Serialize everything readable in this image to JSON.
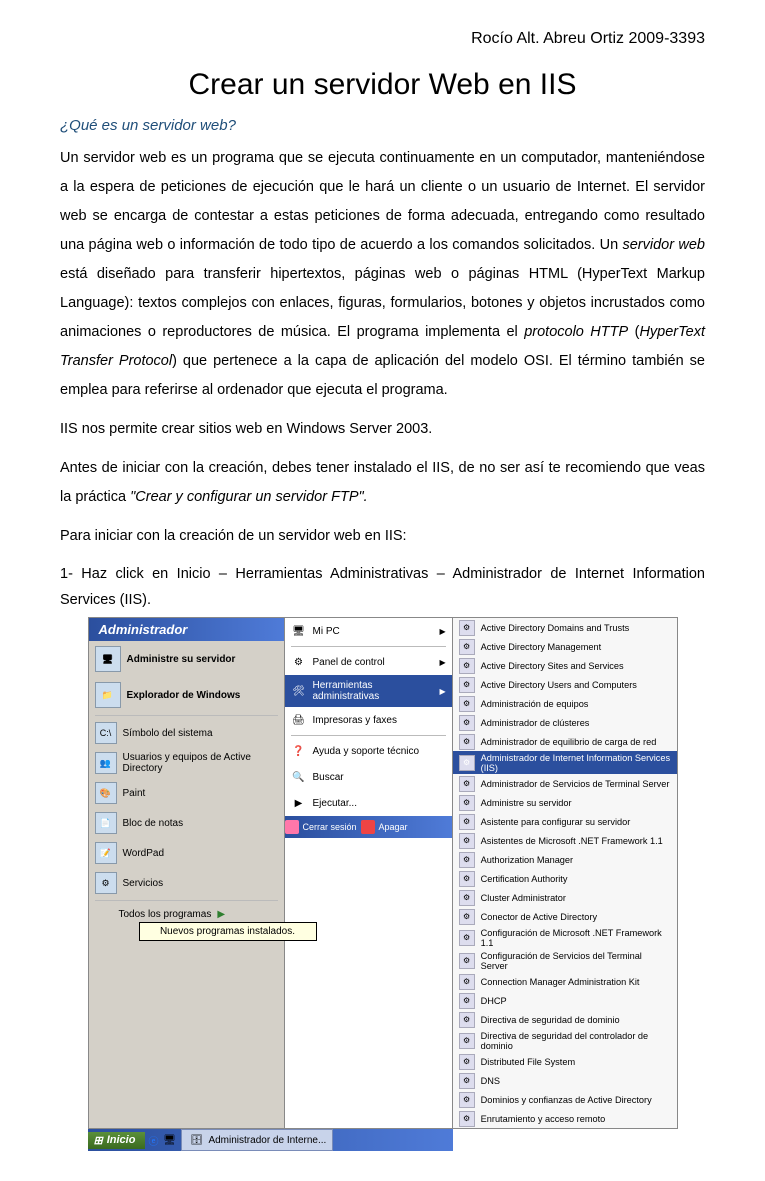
{
  "header_name": "Rocío Alt. Abreu Ortiz 2009-3393",
  "title": "Crear un servidor Web en IIS",
  "subtitle": "¿Qué es un servidor web?",
  "para1_a": "Un servidor web es un programa que se ejecuta continuamente en un computador, manteniéndose a la espera de peticiones de ejecución que le hará un cliente o un usuario de Internet. El servidor web se encarga de contestar a estas peticiones de forma adecuada, entregando como resultado una página web o información de todo tipo de acuerdo a los comandos solicitados. Un ",
  "para1_i1": "servidor web",
  "para1_b": "  está diseñado para transferir hipertextos, páginas web o páginas HTML (HyperText Markup Language): textos complejos con enlaces, figuras, formularios, botones y objetos incrustados como animaciones o reproductores de música. El programa implementa el ",
  "para1_i2": "protocolo HTTP",
  "para1_c": " (",
  "para1_i3": "HyperText Transfer Protocol",
  "para1_d": ") que pertenece a la capa de aplicación del modelo OSI. El término también se emplea para referirse al ordenador que ejecuta el programa.",
  "para2": "IIS nos permite crear sitios web en Windows Server 2003.",
  "para3_a": "Antes de iniciar con la creación, debes tener instalado el IIS, de no ser así te recomiendo que veas la práctica ",
  "para3_i": "\"Crear y configurar un servidor FTP\".",
  "para4": " Para iniciar con la creación de un servidor web en IIS:",
  "step1_a": "1- Haz click en ",
  "step1_i": "Inicio – Herramientas Administrativas – Administrador de Internet Information Services (IIS).",
  "startmenu": {
    "title": "Administrador",
    "left": [
      "Administre su servidor",
      "Explorador de Windows",
      "Símbolo del sistema",
      "Usuarios y equipos de Active Directory",
      "Paint",
      "Bloc de notas",
      "WordPad",
      "Servicios"
    ],
    "all_programs": "Todos los programas",
    "tooltip": "Nuevos programas instalados.",
    "mid": [
      {
        "label": "Mi PC",
        "arrow": true,
        "icon": "🖥"
      },
      {
        "label": "Panel de control",
        "arrow": true,
        "icon": "⚙"
      },
      {
        "label": "Herramientas administrativas",
        "arrow": true,
        "sel": true,
        "icon": "🛠"
      },
      {
        "label": "Impresoras y faxes",
        "arrow": false,
        "icon": "🖨"
      },
      {
        "label": "Ayuda y soporte técnico",
        "arrow": false,
        "icon": "❓"
      },
      {
        "label": "Buscar",
        "arrow": false,
        "icon": "🔍"
      },
      {
        "label": "Ejecutar...",
        "arrow": false,
        "icon": "▶"
      }
    ],
    "right": [
      "Active Directory Domains and Trusts",
      "Active Directory Management",
      "Active Directory Sites and Services",
      "Active Directory Users and Computers",
      "Administración de equipos",
      "Administrador de clústeres",
      "Administrador de equilibrio de carga de red",
      "Administrador de Internet Information Services (IIS)",
      "Administrador de Servicios de Terminal Server",
      "Administre su servidor",
      "Asistente para configurar su servidor",
      "Asistentes de Microsoft .NET Framework 1.1",
      "Authorization Manager",
      "Certification Authority",
      "Cluster Administrator",
      "Conector de Active Directory",
      "Configuración de Microsoft .NET Framework 1.1",
      "Configuración de Servicios del Terminal Server",
      "Connection Manager Administration Kit",
      "DHCP",
      "Directiva de seguridad de dominio",
      "Directiva de seguridad del controlador de dominio",
      "Distributed File System",
      "DNS",
      "Dominios y confianzas de Active Directory",
      "Enrutamiento y acceso remoto"
    ],
    "right_sel_index": 7,
    "logoff": "Cerrar sesión",
    "shutdown": "Apagar",
    "start": "Inicio",
    "task": "Administrador de Interne..."
  }
}
